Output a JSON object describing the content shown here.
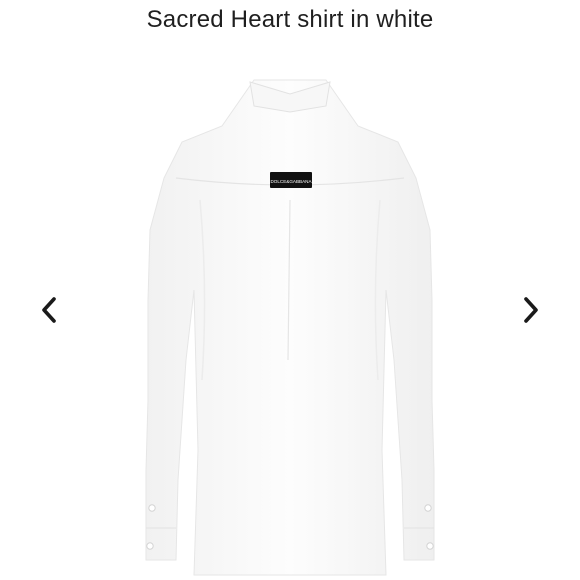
{
  "product": {
    "title": "Sacred Heart shirt in white",
    "label_text": "DOLCE&GABBANA"
  },
  "gallery": {
    "prev_icon": "chevron-left-icon",
    "next_icon": "chevron-right-icon"
  },
  "colors": {
    "shirt": "#fbfbfb",
    "shirt_shadow": "#e9e9e9",
    "label": "#111111",
    "arrow": "#1a1a1a"
  }
}
